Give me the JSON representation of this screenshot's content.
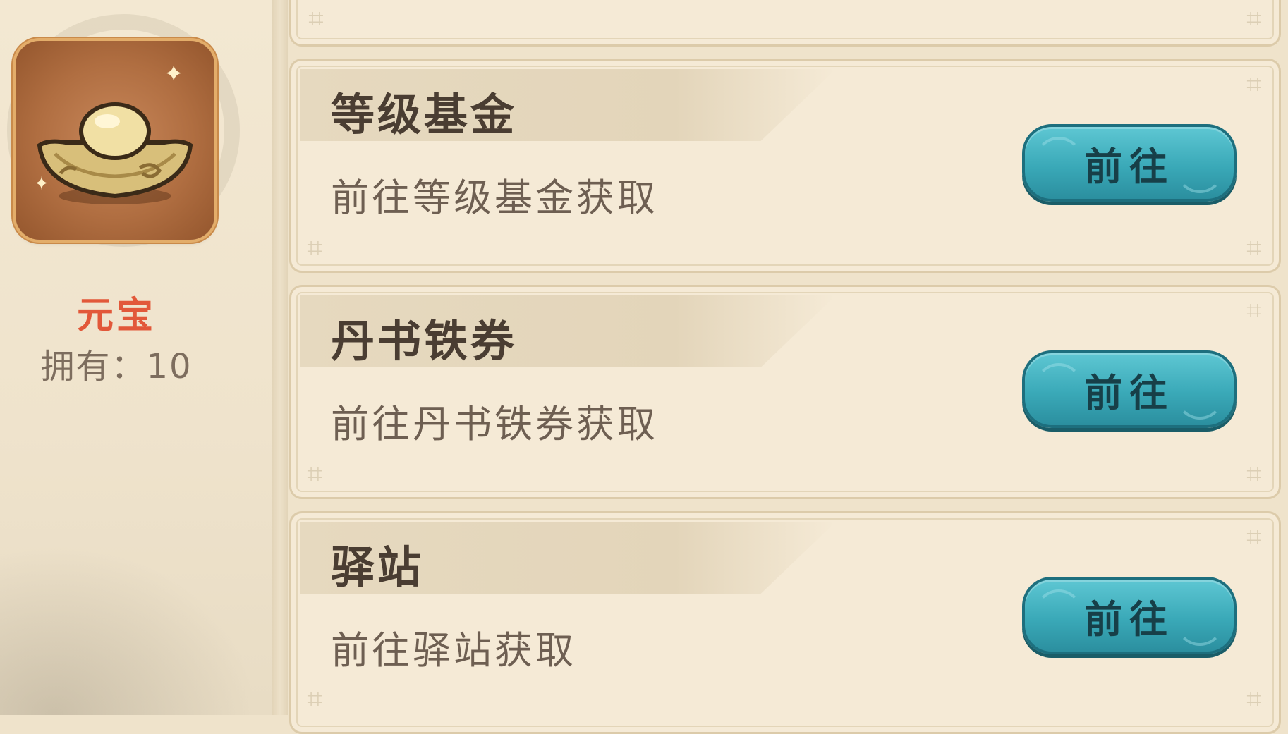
{
  "item": {
    "name": "元宝",
    "owned_label": "拥有：",
    "owned_value": "10",
    "icon": "gold-ingot-icon"
  },
  "sources": [
    {
      "title": "等级基金",
      "desc": "前往等级基金获取",
      "button": "前往"
    },
    {
      "title": "丹书铁券",
      "desc": "前往丹书铁券获取",
      "button": "前往"
    },
    {
      "title": "驿站",
      "desc": "前往驿站获取",
      "button": "前往"
    }
  ],
  "colors": {
    "background": "#efe3cb",
    "card": "#f5ead6",
    "item_name": "#e2583a",
    "button": "#3aa9b8",
    "title_text": "#4a3d32"
  }
}
